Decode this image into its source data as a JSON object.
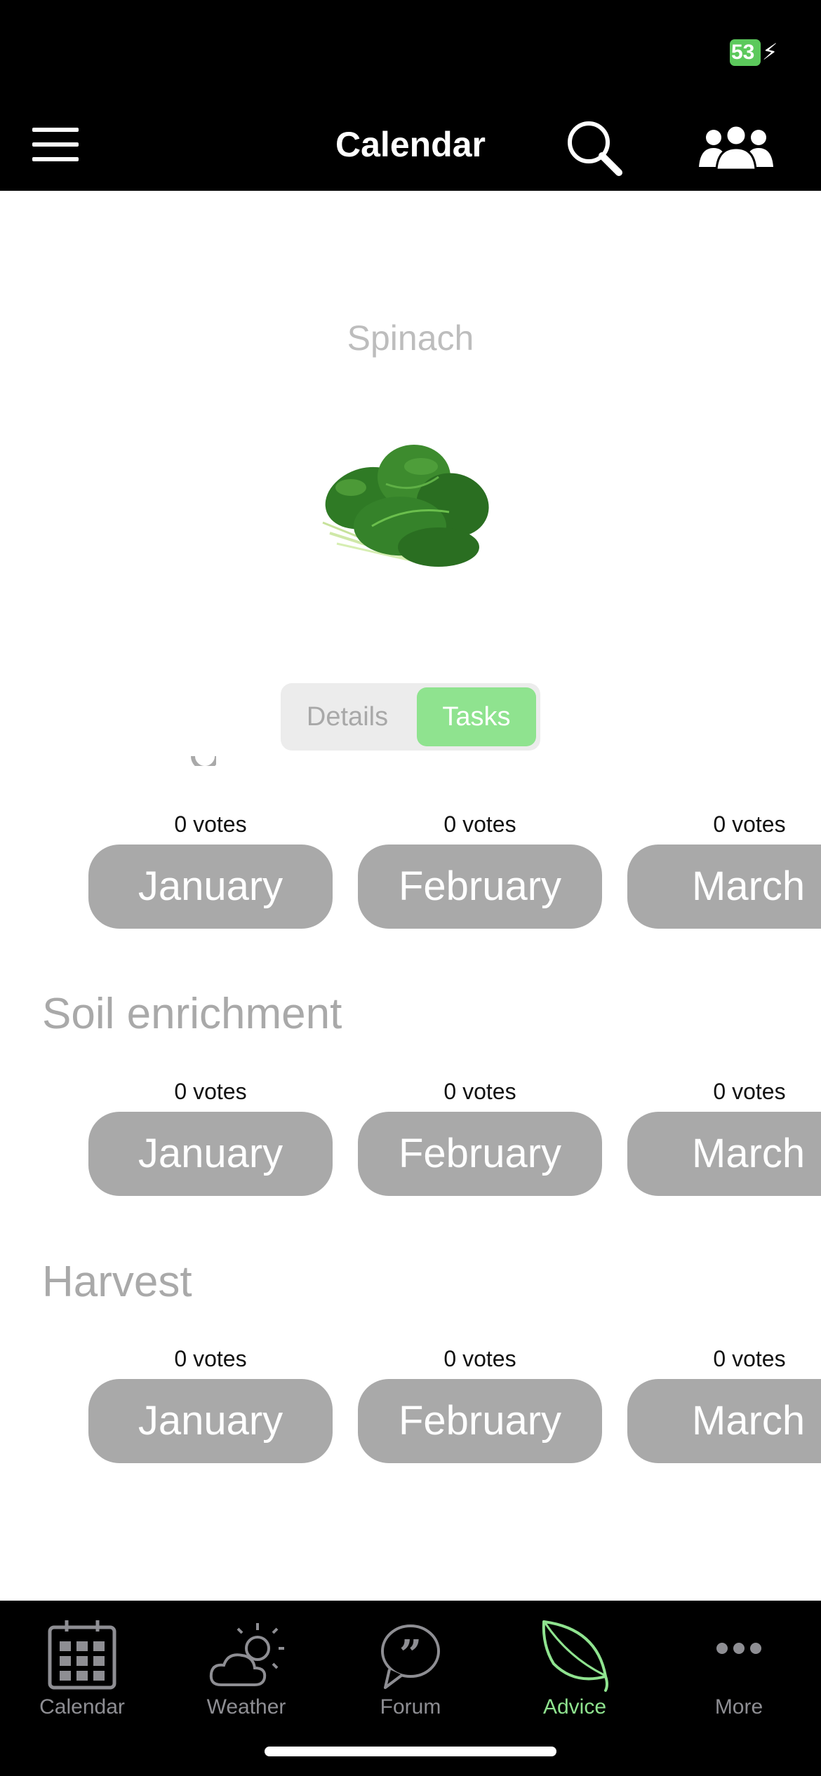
{
  "status_bar": {
    "battery_level": "53"
  },
  "header": {
    "title": "Calendar"
  },
  "crop": {
    "name": "Spinach"
  },
  "segmented": {
    "details_label": "Details",
    "tasks_label": "Tasks",
    "selected": "Tasks"
  },
  "sections": [
    {
      "title": "",
      "months": [
        {
          "votes": "0 votes",
          "month": "January"
        },
        {
          "votes": "0 votes",
          "month": "February"
        },
        {
          "votes": "0 votes",
          "month": "March"
        }
      ]
    },
    {
      "title": "Soil enrichment",
      "months": [
        {
          "votes": "0 votes",
          "month": "January"
        },
        {
          "votes": "0 votes",
          "month": "February"
        },
        {
          "votes": "0 votes",
          "month": "March"
        }
      ]
    },
    {
      "title": "Harvest",
      "months": [
        {
          "votes": "0 votes",
          "month": "January"
        },
        {
          "votes": "0 votes",
          "month": "February"
        },
        {
          "votes": "0 votes",
          "month": "March"
        }
      ]
    }
  ],
  "tab_bar": {
    "items": [
      {
        "label": "Calendar",
        "icon": "calendar-grid-icon"
      },
      {
        "label": "Weather",
        "icon": "cloud-sun-icon"
      },
      {
        "label": "Forum",
        "icon": "quote-bubble-icon"
      },
      {
        "label": "Advice",
        "icon": "leaf-icon"
      },
      {
        "label": "More",
        "icon": "more-dots-icon"
      }
    ],
    "active": "Advice"
  },
  "colors": {
    "accent": "#8fe38f",
    "month_button": "#a9a9a9",
    "bar_background": "#000000",
    "inactive_tab": "#8e8e93"
  }
}
